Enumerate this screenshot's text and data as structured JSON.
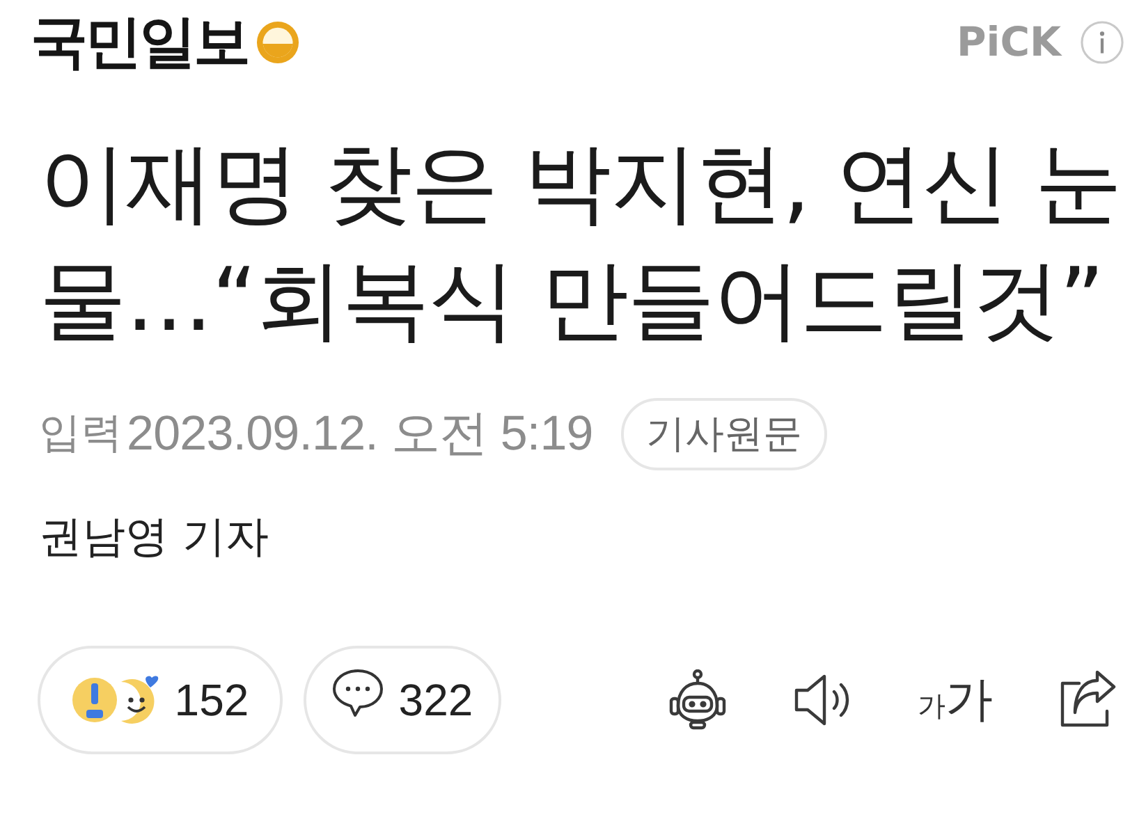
{
  "header": {
    "logo": "국민일보",
    "badge": "PiCK"
  },
  "article": {
    "headline": "이재명 찾은 박지현, 연신 눈물…“회복식 만들어드릴것”",
    "input_label": "입력",
    "published": "2023.09.12. 오전 5:19",
    "original_button": "기사원문",
    "byline": "권남영 기자"
  },
  "actions": {
    "reactions": {
      "count": "152"
    },
    "comments": {
      "count": "322"
    },
    "font_size": {
      "small": "가",
      "large": "가"
    }
  }
}
